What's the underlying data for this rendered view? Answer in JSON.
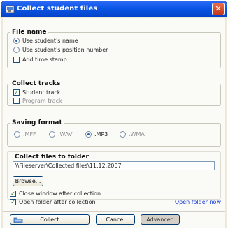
{
  "window": {
    "title": "Collect student files",
    "close_glyph": "✕"
  },
  "file_name": {
    "legend": "File name",
    "options": [
      {
        "label": "Use student's name",
        "checked": true
      },
      {
        "label": "Use student's position number",
        "checked": false
      }
    ],
    "timestamp_label": "Add time stamp",
    "timestamp_checked": false
  },
  "collect_tracks": {
    "legend": "Collect tracks",
    "student_track": "Student track",
    "program_track": "Program track"
  },
  "saving_format": {
    "legend": "Saving format",
    "formats": [
      ".MFF",
      ".WAV",
      ".MP3",
      ".WMA"
    ],
    "selected": ".MP3"
  },
  "collect_folder": {
    "legend": "Collect files to folder",
    "path": "\\\\Fileserver\\Collected files\\11.12.2007",
    "browse_label": "Browse..."
  },
  "options": {
    "close_after": "Close window after collection",
    "open_after": "Open folder after collection",
    "open_folder_now": "Open folder now"
  },
  "buttons": {
    "collect": "Collect",
    "cancel": "Cancel",
    "advanced": "Advanced"
  },
  "colors": {
    "title_bar": "#0a55e6",
    "link": "#1133cc"
  },
  "icons": [
    "app-icon",
    "close-icon",
    "collect-icon"
  ]
}
